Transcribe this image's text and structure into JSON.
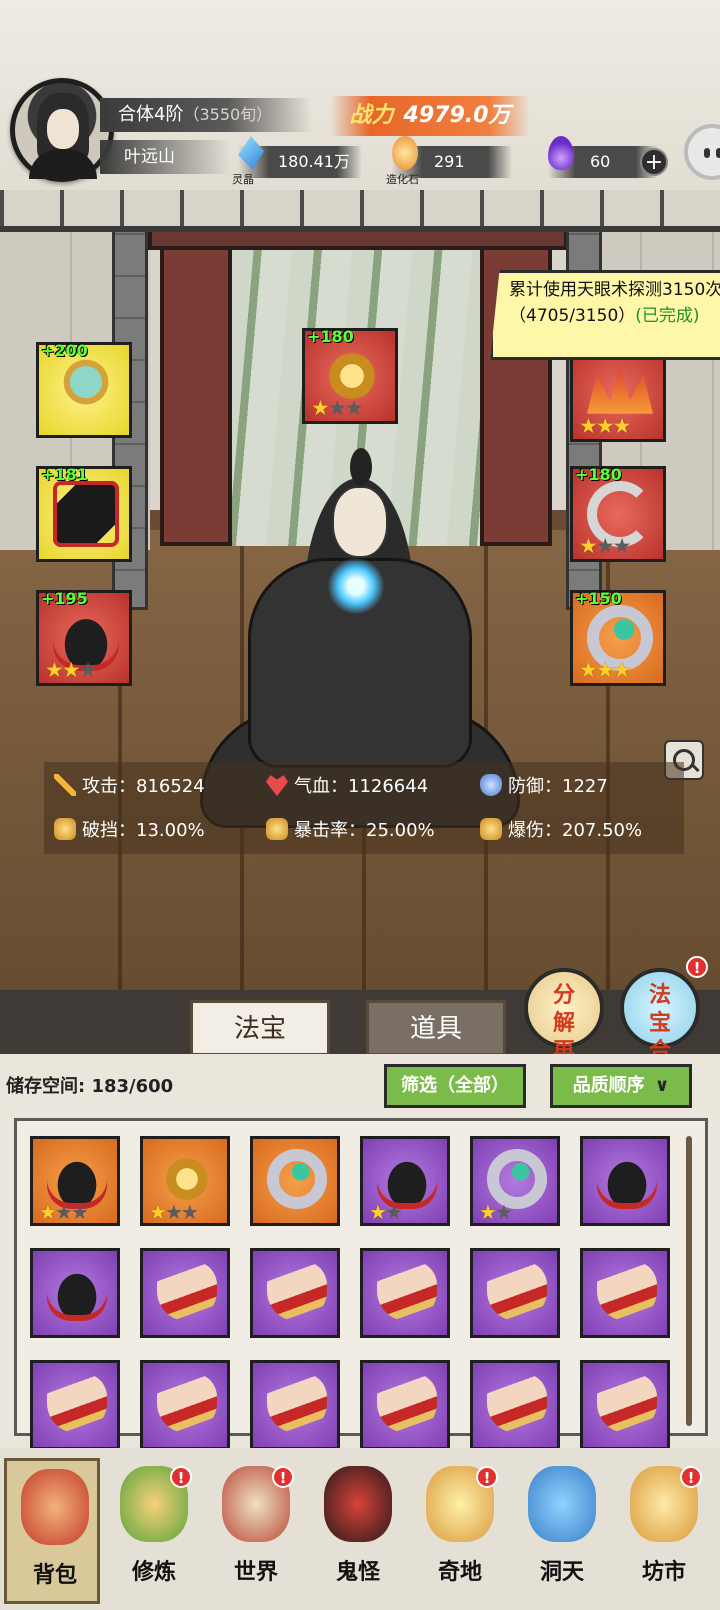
{
  "player": {
    "realm": "合体4阶",
    "realm_progress": "（3550旬）",
    "name": "叶远山",
    "power_label": "战力",
    "power_value": "4979.0万"
  },
  "resources": [
    {
      "icon": "blue-crystal-icon",
      "label": "灵晶",
      "value": "180.41万"
    },
    {
      "icon": "orange-stone-icon",
      "label": "造化石",
      "value": "291"
    },
    {
      "icon": "purple-flame-icon",
      "label": "",
      "value": "60"
    }
  ],
  "quest": {
    "text": "累计使用天眼术探测3150次（4705/3150）",
    "status": "(已完成)"
  },
  "equipment": {
    "left": [
      {
        "bonus": "+200",
        "quality": "yellow",
        "item": "mirror",
        "stars": 0
      },
      {
        "bonus": "+181",
        "quality": "yellow",
        "item": "robe",
        "stars": 0
      },
      {
        "bonus": "+195",
        "quality": "red",
        "item": "boot",
        "stars": 2
      }
    ],
    "center": {
      "bonus": "+180",
      "quality": "red",
      "item": "dragon",
      "stars": 1
    },
    "right": [
      {
        "bonus": "",
        "quality": "red",
        "item": "crown",
        "stars": 3
      },
      {
        "bonus": "+180",
        "quality": "red",
        "item": "amulet",
        "stars": 1
      },
      {
        "bonus": "+150",
        "quality": "orange",
        "item": "ring",
        "stars": 3
      }
    ]
  },
  "stats": {
    "attack": "攻击：816524",
    "hp": "气血：1126644",
    "defense": "防御：1227",
    "pierce": "破挡：13.00%",
    "crit_rate": "暴击率：25.00%",
    "crit_dmg": "爆伤：207.50%"
  },
  "tabs": {
    "active": "法宝",
    "inactive": "道具"
  },
  "action_buttons": {
    "decompose": "分解再造",
    "synthesize": "法宝合成",
    "badge": "!"
  },
  "inventory": {
    "storage_label": "储存空间: 183/600",
    "filter": "筛选（全部）",
    "sort": "品质顺序",
    "rows": [
      [
        {
          "quality": "orange",
          "item": "boot",
          "stars": 1,
          "max": 3
        },
        {
          "quality": "orange",
          "item": "dragon",
          "stars": 1,
          "max": 3
        },
        {
          "quality": "orange",
          "item": "ring",
          "stars": 0,
          "max": 0
        },
        {
          "quality": "purple",
          "item": "boot",
          "stars": 1,
          "max": 2
        },
        {
          "quality": "purple",
          "item": "ring",
          "stars": 1,
          "max": 2
        },
        {
          "quality": "purple",
          "item": "boot",
          "stars": 0,
          "max": 0
        }
      ],
      [
        {
          "quality": "purple",
          "item": "boot",
          "stars": 0,
          "max": 0
        },
        {
          "quality": "purple",
          "item": "claw",
          "stars": 0,
          "max": 0
        },
        {
          "quality": "purple",
          "item": "claw",
          "stars": 0,
          "max": 0
        },
        {
          "quality": "purple",
          "item": "claw",
          "stars": 0,
          "max": 0
        },
        {
          "quality": "purple",
          "item": "claw",
          "stars": 0,
          "max": 0
        },
        {
          "quality": "purple",
          "item": "claw",
          "stars": 0,
          "max": 0
        }
      ],
      [
        {
          "quality": "purple",
          "item": "claw",
          "stars": 0,
          "max": 0
        },
        {
          "quality": "purple",
          "item": "claw",
          "stars": 0,
          "max": 0
        },
        {
          "quality": "purple",
          "item": "claw",
          "stars": 0,
          "max": 0
        },
        {
          "quality": "purple",
          "item": "claw",
          "stars": 0,
          "max": 0
        },
        {
          "quality": "purple",
          "item": "claw",
          "stars": 0,
          "max": 0
        },
        {
          "quality": "purple",
          "item": "claw",
          "stars": 0,
          "max": 0
        }
      ]
    ]
  },
  "nav": [
    {
      "label": "背包",
      "icon": "bag",
      "active": true,
      "badge": false
    },
    {
      "label": "修炼",
      "icon": "cult",
      "active": false,
      "badge": true
    },
    {
      "label": "世界",
      "icon": "world",
      "active": false,
      "badge": true
    },
    {
      "label": "鬼怪",
      "icon": "ghost",
      "active": false,
      "badge": false
    },
    {
      "label": "奇地",
      "icon": "land",
      "active": false,
      "badge": true
    },
    {
      "label": "洞天",
      "icon": "cave",
      "active": false,
      "badge": false
    },
    {
      "label": "坊市",
      "icon": "market",
      "active": false,
      "badge": true
    }
  ]
}
